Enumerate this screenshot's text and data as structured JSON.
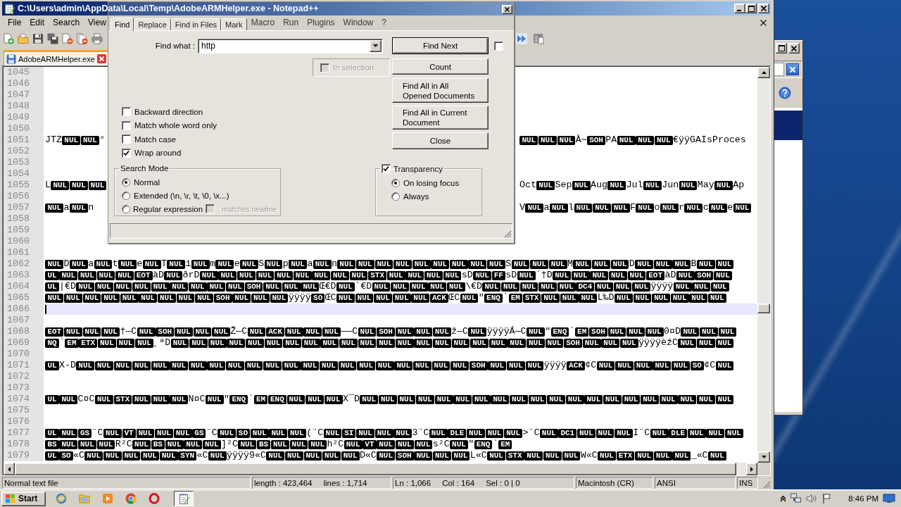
{
  "window": {
    "title": "C:\\Users\\admin\\AppData\\Local\\Temp\\AdobeARMHelper.exe - Notepad++"
  },
  "menu": {
    "items": [
      "File",
      "Edit",
      "Search",
      "View"
    ],
    "items_seen_through_dialog": [
      "Macro",
      "Run",
      "Plugins",
      "Window",
      "?"
    ]
  },
  "tabs": [
    {
      "label": "AdobeARMHelper.exe",
      "selected": true
    }
  ],
  "editor": {
    "lines": [
      {
        "number": "1045",
        "current": false
      },
      {
        "number": "1046",
        "current": false
      },
      {
        "number": "1047",
        "current": false
      },
      {
        "number": "1048",
        "current": false
      },
      {
        "number": "1049",
        "current": false
      },
      {
        "number": "1050",
        "current": false
      },
      {
        "number": "1051",
        "current": false,
        "left_part": [
          {
            "text": "JTZ"
          },
          {
            "ctrl": "NUL"
          },
          {
            "ctrl": "NUL"
          },
          {
            "text": "°"
          }
        ],
        "right_part": [
          {
            "ctrl": "NUL"
          },
          {
            "ctrl": "NUL"
          },
          {
            "ctrl": "NUL"
          },
          {
            "text": "À~"
          },
          {
            "ctrl": "SOH"
          },
          {
            "text": "PA"
          },
          {
            "ctrl": "NUL"
          },
          {
            "ctrl": "NUL"
          },
          {
            "ctrl": "NUL"
          },
          {
            "text": "€ÿÿGAIsProces"
          }
        ]
      },
      {
        "number": "1052",
        "current": false
      },
      {
        "number": "1053",
        "current": false
      },
      {
        "number": "1054",
        "current": false
      },
      {
        "number": "1055",
        "current": false,
        "left_part": [
          {
            "text": "L"
          },
          {
            "ctrl": "NUL"
          },
          {
            "ctrl": "NUL"
          },
          {
            "ctrl": "NUL"
          }
        ],
        "right_part": [
          {
            "text": "Oct"
          },
          {
            "ctrl": "NUL"
          },
          {
            "text": "Sep"
          },
          {
            "ctrl": "NUL"
          },
          {
            "text": "Aug"
          },
          {
            "ctrl": "NUL"
          },
          {
            "text": "Jul"
          },
          {
            "ctrl": "NUL"
          },
          {
            "text": "Jun"
          },
          {
            "ctrl": "NUL"
          },
          {
            "text": "May"
          },
          {
            "ctrl": "NUL"
          },
          {
            "text": "Ap"
          }
        ]
      },
      {
        "number": "1056",
        "current": false
      },
      {
        "number": "1057",
        "current": false,
        "left_part": [
          {
            "ctrl": "NUL"
          },
          {
            "text": "a"
          },
          {
            "ctrl": "NUL"
          },
          {
            "text": "n"
          }
        ],
        "right_part": [
          {
            "text": "V"
          },
          {
            "ctrl": "NUL"
          },
          {
            "text": "a"
          },
          {
            "ctrl": "NUL"
          },
          {
            "text": "l"
          },
          {
            "ctrl": "NUL"
          },
          {
            "ctrl": "NUL"
          },
          {
            "ctrl": "NUL"
          },
          {
            "text": "F"
          },
          {
            "ctrl": "NUL"
          },
          {
            "text": "o"
          },
          {
            "ctrl": "NUL"
          },
          {
            "text": "r"
          },
          {
            "ctrl": "NUL"
          },
          {
            "text": "c"
          },
          {
            "ctrl": "NUL"
          },
          {
            "text": "e"
          },
          {
            "ctrl": "NUL"
          }
        ]
      },
      {
        "number": "1058",
        "current": false
      },
      {
        "number": "1059",
        "current": false
      },
      {
        "number": "1060",
        "current": false
      },
      {
        "number": "1061",
        "current": false
      },
      {
        "number": "1062",
        "current": false,
        "segments": [
          {
            "ctrl": "NUL"
          },
          {
            "text": "D"
          },
          {
            "ctrl": "NUL"
          },
          {
            "text": "a"
          },
          {
            "ctrl": "NUL"
          },
          {
            "text": "t"
          },
          {
            "ctrl": "NUL"
          },
          {
            "text": "e"
          },
          {
            "ctrl": "NUL"
          },
          {
            "text": "T"
          },
          {
            "ctrl": "NUL"
          },
          {
            "text": "i"
          },
          {
            "ctrl": "NUL"
          },
          {
            "text": "m"
          },
          {
            "ctrl": "NUL"
          },
          {
            "text": "e"
          },
          {
            "ctrl": "NUL"
          },
          {
            "text": "S"
          },
          {
            "ctrl": "NUL"
          },
          {
            "text": "p"
          },
          {
            "ctrl": "NUL"
          },
          {
            "text": "a"
          },
          {
            "ctrl": "NUL"
          },
          {
            "text": "n"
          },
          {
            "ctrl": "NUL"
          },
          {
            "ctrl": "NUL"
          },
          {
            "ctrl": "NUL"
          },
          {
            "ctrl": "NUL"
          },
          {
            "ctrl": "NUL"
          },
          {
            "ctrl": "NUL"
          },
          {
            "ctrl": "NUL"
          },
          {
            "ctrl": "NUL"
          },
          {
            "ctrl": "NUL"
          },
          {
            "text": "S"
          },
          {
            "ctrl": "NUL"
          },
          {
            "ctrl": "NUL"
          },
          {
            "ctrl": "NUL"
          },
          {
            "text": "M"
          },
          {
            "ctrl": "NUL"
          },
          {
            "ctrl": "NUL"
          },
          {
            "ctrl": "NUL"
          },
          {
            "text": "D"
          },
          {
            "ctrl": "NUL"
          },
          {
            "ctrl": "NUL"
          },
          {
            "ctrl": "NUL"
          },
          {
            "text": "B"
          },
          {
            "ctrl": "NUL"
          },
          {
            "ctrl": "NUL"
          }
        ]
      },
      {
        "number": "1063",
        "current": false,
        "segments": [
          {
            "ctrl": "UL"
          },
          {
            "ctrl": "NUL"
          },
          {
            "ctrl": "NUL"
          },
          {
            "ctrl": "NUL"
          },
          {
            "ctrl": "NUL"
          },
          {
            "ctrl": "EOT"
          },
          {
            "text": "àD"
          },
          {
            "ctrl": "NUL"
          },
          {
            "text": "ðrD"
          },
          {
            "ctrl": "NUL"
          },
          {
            "ctrl": "NUL"
          },
          {
            "ctrl": "NUL"
          },
          {
            "ctrl": "NUL"
          },
          {
            "ctrl": "NUL"
          },
          {
            "ctrl": "NUL"
          },
          {
            "ctrl": "NUL"
          },
          {
            "ctrl": "NUL"
          },
          {
            "ctrl": "NUL"
          },
          {
            "ctrl": "STX"
          },
          {
            "ctrl": "NUL"
          },
          {
            "ctrl": "NUL"
          },
          {
            "ctrl": "NUL"
          },
          {
            "ctrl": "NUL"
          },
          {
            "text": "sD"
          },
          {
            "ctrl": "NUL"
          },
          {
            "ctrl": "FF"
          },
          {
            "text": "sD"
          },
          {
            "ctrl": "NUL"
          },
          {
            "text": "´†D"
          },
          {
            "ctrl": "NUL"
          },
          {
            "ctrl": "NUL"
          },
          {
            "ctrl": "NUL"
          },
          {
            "ctrl": "NUL"
          },
          {
            "ctrl": "NUL"
          },
          {
            "ctrl": "EOT"
          },
          {
            "text": "àD"
          },
          {
            "ctrl": "NUL"
          },
          {
            "ctrl": "SOH"
          },
          {
            "ctrl": "NUL"
          }
        ]
      },
      {
        "number": "1064",
        "current": false,
        "segments": [
          {
            "ctrl": "UL"
          },
          {
            "text": "|€D"
          },
          {
            "ctrl": "NUL"
          },
          {
            "ctrl": "NUL"
          },
          {
            "ctrl": "NUL"
          },
          {
            "ctrl": "NUL"
          },
          {
            "ctrl": "NUL"
          },
          {
            "ctrl": "NUL"
          },
          {
            "ctrl": "NUL"
          },
          {
            "ctrl": "NUL"
          },
          {
            "ctrl": "NUL"
          },
          {
            "ctrl": "SOH"
          },
          {
            "ctrl": "NUL"
          },
          {
            "ctrl": "NUL"
          },
          {
            "ctrl": "NUL"
          },
          {
            "text": "Œ€D"
          },
          {
            "ctrl": "NUL"
          },
          {
            "text": "`€D"
          },
          {
            "ctrl": "NUL"
          },
          {
            "ctrl": "NUL"
          },
          {
            "ctrl": "NUL"
          },
          {
            "ctrl": "NUL"
          },
          {
            "ctrl": "NUL"
          },
          {
            "text": "\\€D"
          },
          {
            "ctrl": "NUL"
          },
          {
            "ctrl": "NUL"
          },
          {
            "ctrl": "NUL"
          },
          {
            "ctrl": "NUL"
          },
          {
            "ctrl": "NUL"
          },
          {
            "ctrl": "DC4"
          },
          {
            "ctrl": "NUL"
          },
          {
            "ctrl": "NUL"
          },
          {
            "ctrl": "NUL"
          },
          {
            "text": "ÿÿÿÿ"
          },
          {
            "ctrl": "NUL"
          },
          {
            "ctrl": "NUL"
          },
          {
            "ctrl": "NUL"
          }
        ]
      },
      {
        "number": "1065",
        "current": false,
        "segments": [
          {
            "ctrl": "NUL"
          },
          {
            "ctrl": "NUL"
          },
          {
            "ctrl": "NUL"
          },
          {
            "ctrl": "NUL"
          },
          {
            "ctrl": "NUL"
          },
          {
            "ctrl": "NUL"
          },
          {
            "ctrl": "NUL"
          },
          {
            "ctrl": "NUL"
          },
          {
            "ctrl": "NUL"
          },
          {
            "ctrl": "SOH"
          },
          {
            "ctrl": "NUL"
          },
          {
            "ctrl": "NUL"
          },
          {
            "ctrl": "NUL"
          },
          {
            "text": "ÿÿÿÿ"
          },
          {
            "ctrl": "SO"
          },
          {
            "text": "ŒC"
          },
          {
            "ctrl": "NUL"
          },
          {
            "ctrl": "NUL"
          },
          {
            "ctrl": "NUL"
          },
          {
            "ctrl": "NUL"
          },
          {
            "ctrl": "NUL"
          },
          {
            "ctrl": "ACK"
          },
          {
            "text": "ŒC"
          },
          {
            "ctrl": "NUL"
          },
          {
            "text": "\""
          },
          {
            "ctrl": "ENQ"
          },
          {
            "text": "`"
          },
          {
            "ctrl": "EM"
          },
          {
            "ctrl": "STX"
          },
          {
            "ctrl": "NUL"
          },
          {
            "ctrl": "NUL"
          },
          {
            "ctrl": "NUL"
          },
          {
            "text": "L‰D"
          },
          {
            "ctrl": "NUL"
          },
          {
            "ctrl": "NUL"
          },
          {
            "ctrl": "NUL"
          },
          {
            "ctrl": "NUL"
          },
          {
            "ctrl": "NUL"
          },
          {
            "ctrl": "NUL"
          }
        ]
      },
      {
        "number": "1066",
        "current": true
      },
      {
        "number": "1067",
        "current": false
      },
      {
        "number": "1068",
        "current": false,
        "segments": [
          {
            "ctrl": "EOT"
          },
          {
            "ctrl": "NUL"
          },
          {
            "ctrl": "NUL"
          },
          {
            "ctrl": "NUL"
          },
          {
            "text": "†—C"
          },
          {
            "ctrl": "NUL"
          },
          {
            "ctrl": "SOH"
          },
          {
            "ctrl": "NUL"
          },
          {
            "ctrl": "NUL"
          },
          {
            "ctrl": "NUL"
          },
          {
            "text": "Ž—C"
          },
          {
            "ctrl": "NUL"
          },
          {
            "ctrl": "ACK"
          },
          {
            "ctrl": "NUL"
          },
          {
            "ctrl": "NUL"
          },
          {
            "ctrl": "NUL"
          },
          {
            "text": "——C"
          },
          {
            "ctrl": "NUL"
          },
          {
            "ctrl": "SOH"
          },
          {
            "ctrl": "NUL"
          },
          {
            "ctrl": "NUL"
          },
          {
            "ctrl": "NUL"
          },
          {
            "text": "ž—C"
          },
          {
            "ctrl": "NUL"
          },
          {
            "text": "ÿÿÿÿÁ—C"
          },
          {
            "ctrl": "NUL"
          },
          {
            "text": "\""
          },
          {
            "ctrl": "ENQ"
          },
          {
            "text": "`"
          },
          {
            "ctrl": "EM"
          },
          {
            "ctrl": "SOH"
          },
          {
            "ctrl": "NUL"
          },
          {
            "ctrl": "NUL"
          },
          {
            "ctrl": "NUL"
          },
          {
            "text": "0¤D"
          },
          {
            "ctrl": "NUL"
          },
          {
            "ctrl": "NUL"
          },
          {
            "ctrl": "NUL"
          }
        ]
      },
      {
        "number": "1069",
        "current": false,
        "segments": [
          {
            "ctrl": "NQ"
          },
          {
            "text": "`"
          },
          {
            "ctrl": "EM"
          },
          {
            "ctrl": "ETX"
          },
          {
            "ctrl": "NUL"
          },
          {
            "ctrl": "NUL"
          },
          {
            "ctrl": "NUL"
          },
          {
            "text": "¸ªD"
          },
          {
            "ctrl": "NUL"
          },
          {
            "ctrl": "NUL"
          },
          {
            "ctrl": "NUL"
          },
          {
            "ctrl": "NUL"
          },
          {
            "ctrl": "NUL"
          },
          {
            "ctrl": "NUL"
          },
          {
            "ctrl": "NUL"
          },
          {
            "ctrl": "NUL"
          },
          {
            "ctrl": "NUL"
          },
          {
            "ctrl": "NUL"
          },
          {
            "ctrl": "NUL"
          },
          {
            "ctrl": "NUL"
          },
          {
            "ctrl": "NUL"
          },
          {
            "ctrl": "NUL"
          },
          {
            "ctrl": "NUL"
          },
          {
            "ctrl": "NUL"
          },
          {
            "ctrl": "NUL"
          },
          {
            "ctrl": "NUL"
          },
          {
            "ctrl": "NUL"
          },
          {
            "ctrl": "NUL"
          },
          {
            "ctrl": "NUL"
          },
          {
            "ctrl": "SOH"
          },
          {
            "ctrl": "NUL"
          },
          {
            "ctrl": "NUL"
          },
          {
            "ctrl": "NUL"
          },
          {
            "text": "ÿÿÿÿèžC"
          },
          {
            "ctrl": "NUL"
          },
          {
            "ctrl": "NUL"
          },
          {
            "ctrl": "NUL"
          }
        ]
      },
      {
        "number": "1070",
        "current": false
      },
      {
        "number": "1071",
        "current": false,
        "segments": [
          {
            "ctrl": "UL"
          },
          {
            "text": "X-D"
          },
          {
            "ctrl": "NUL"
          },
          {
            "ctrl": "NUL"
          },
          {
            "ctrl": "NUL"
          },
          {
            "ctrl": "NUL"
          },
          {
            "ctrl": "NUL"
          },
          {
            "ctrl": "NUL"
          },
          {
            "ctrl": "NUL"
          },
          {
            "ctrl": "NUL"
          },
          {
            "ctrl": "NUL"
          },
          {
            "ctrl": "NUL"
          },
          {
            "ctrl": "NUL"
          },
          {
            "ctrl": "NUL"
          },
          {
            "ctrl": "NUL"
          },
          {
            "ctrl": "NUL"
          },
          {
            "ctrl": "NUL"
          },
          {
            "ctrl": "NUL"
          },
          {
            "ctrl": "NUL"
          },
          {
            "ctrl": "NUL"
          },
          {
            "ctrl": "NUL"
          },
          {
            "ctrl": "NUL"
          },
          {
            "ctrl": "NUL"
          },
          {
            "ctrl": "SOH"
          },
          {
            "ctrl": "NUL"
          },
          {
            "ctrl": "NUL"
          },
          {
            "ctrl": "NUL"
          },
          {
            "text": "ÿÿÿÿ"
          },
          {
            "ctrl": "ACK"
          },
          {
            "text": "¢C"
          },
          {
            "ctrl": "NUL"
          },
          {
            "ctrl": "NUL"
          },
          {
            "ctrl": "NUL"
          },
          {
            "ctrl": "NUL"
          },
          {
            "ctrl": "NUL"
          },
          {
            "ctrl": "SO"
          },
          {
            "text": "¢C"
          },
          {
            "ctrl": "NUL"
          }
        ]
      },
      {
        "number": "1072",
        "current": false
      },
      {
        "number": "1073",
        "current": false
      },
      {
        "number": "1074",
        "current": false,
        "segments": [
          {
            "ctrl": "UL"
          },
          {
            "ctrl": "NUL"
          },
          {
            "text": "C¤C"
          },
          {
            "ctrl": "NUL"
          },
          {
            "ctrl": "STX"
          },
          {
            "ctrl": "NUL"
          },
          {
            "ctrl": "NUL"
          },
          {
            "ctrl": "NUL"
          },
          {
            "text": "N¤C"
          },
          {
            "ctrl": "NUL"
          },
          {
            "text": "\""
          },
          {
            "ctrl": "ENQ"
          },
          {
            "text": "`"
          },
          {
            "ctrl": "EM"
          },
          {
            "ctrl": "ENQ"
          },
          {
            "ctrl": "NUL"
          },
          {
            "ctrl": "NUL"
          },
          {
            "ctrl": "NUL"
          },
          {
            "text": "X¯D"
          },
          {
            "ctrl": "NUL"
          },
          {
            "ctrl": "NUL"
          },
          {
            "ctrl": "NUL"
          },
          {
            "ctrl": "NUL"
          },
          {
            "ctrl": "NUL"
          },
          {
            "ctrl": "NUL"
          },
          {
            "ctrl": "NUL"
          },
          {
            "ctrl": "NUL"
          },
          {
            "ctrl": "NUL"
          },
          {
            "ctrl": "NUL"
          },
          {
            "ctrl": "NUL"
          },
          {
            "ctrl": "NUL"
          },
          {
            "ctrl": "NUL"
          },
          {
            "ctrl": "NUL"
          },
          {
            "ctrl": "NUL"
          },
          {
            "ctrl": "NUL"
          },
          {
            "ctrl": "NUL"
          },
          {
            "ctrl": "NUL"
          },
          {
            "ctrl": "NUL"
          },
          {
            "ctrl": "NUL"
          }
        ]
      },
      {
        "number": "1075",
        "current": false
      },
      {
        "number": "1076",
        "current": false
      },
      {
        "number": "1077",
        "current": false,
        "segments": [
          {
            "ctrl": "UL"
          },
          {
            "ctrl": "NUL"
          },
          {
            "ctrl": "GS"
          },
          {
            "text": "¨C"
          },
          {
            "ctrl": "NUL"
          },
          {
            "ctrl": "VT"
          },
          {
            "ctrl": "NUL"
          },
          {
            "ctrl": "NUL"
          },
          {
            "ctrl": "NUL"
          },
          {
            "ctrl": "GS"
          },
          {
            "text": "¨C"
          },
          {
            "ctrl": "NUL"
          },
          {
            "ctrl": "SO"
          },
          {
            "ctrl": "NUL"
          },
          {
            "ctrl": "NUL"
          },
          {
            "ctrl": "NUL"
          },
          {
            "text": "(¨C"
          },
          {
            "ctrl": "NUL"
          },
          {
            "ctrl": "SI"
          },
          {
            "ctrl": "NUL"
          },
          {
            "ctrl": "NUL"
          },
          {
            "ctrl": "NUL"
          },
          {
            "text": "3¨C"
          },
          {
            "ctrl": "NUL"
          },
          {
            "ctrl": "DLE"
          },
          {
            "ctrl": "NUL"
          },
          {
            "ctrl": "NUL"
          },
          {
            "ctrl": "NUL"
          },
          {
            "text": ">¨C"
          },
          {
            "ctrl": "NUL"
          },
          {
            "ctrl": "DC1"
          },
          {
            "ctrl": "NUL"
          },
          {
            "ctrl": "NUL"
          },
          {
            "ctrl": "NUL"
          },
          {
            "text": "I¨C"
          },
          {
            "ctrl": "NUL"
          },
          {
            "ctrl": "DLE"
          },
          {
            "ctrl": "NUL"
          },
          {
            "ctrl": "NUL"
          },
          {
            "ctrl": "NUL"
          }
        ]
      },
      {
        "number": "1078",
        "current": false,
        "segments": [
          {
            "ctrl": "BS"
          },
          {
            "ctrl": "NUL"
          },
          {
            "ctrl": "NUL"
          },
          {
            "ctrl": "NUL"
          },
          {
            "text": "R²C"
          },
          {
            "ctrl": "NUL"
          },
          {
            "ctrl": "BS"
          },
          {
            "ctrl": "NUL"
          },
          {
            "ctrl": "NUL"
          },
          {
            "ctrl": "NUL"
          },
          {
            "text": "]²C"
          },
          {
            "ctrl": "NUL"
          },
          {
            "ctrl": "BS"
          },
          {
            "ctrl": "NUL"
          },
          {
            "ctrl": "NUL"
          },
          {
            "ctrl": "NUL"
          },
          {
            "text": "h²C"
          },
          {
            "ctrl": "NUL"
          },
          {
            "ctrl": "VT"
          },
          {
            "ctrl": "NUL"
          },
          {
            "ctrl": "NUL"
          },
          {
            "ctrl": "NUL"
          },
          {
            "text": "s²C"
          },
          {
            "ctrl": "NUL"
          },
          {
            "text": "\""
          },
          {
            "ctrl": "ENQ"
          },
          {
            "text": "`"
          },
          {
            "ctrl": "EM"
          }
        ]
      },
      {
        "number": "1079",
        "current": false,
        "segments": [
          {
            "ctrl": "UL"
          },
          {
            "ctrl": "SO"
          },
          {
            "text": "«C"
          },
          {
            "ctrl": "NUL"
          },
          {
            "ctrl": "NUL"
          },
          {
            "ctrl": "NUL"
          },
          {
            "ctrl": "NUL"
          },
          {
            "ctrl": "NUL"
          },
          {
            "ctrl": "SYN"
          },
          {
            "text": "«C"
          },
          {
            "ctrl": "NUL"
          },
          {
            "text": "ÿÿÿÿ9«C"
          },
          {
            "ctrl": "NUL"
          },
          {
            "ctrl": "NUL"
          },
          {
            "ctrl": "NUL"
          },
          {
            "ctrl": "NUL"
          },
          {
            "ctrl": "NUL"
          },
          {
            "text": "D«C"
          },
          {
            "ctrl": "NUL"
          },
          {
            "ctrl": "SOH"
          },
          {
            "ctrl": "NUL"
          },
          {
            "ctrl": "NUL"
          },
          {
            "ctrl": "NUL"
          },
          {
            "text": "L«C"
          },
          {
            "ctrl": "NUL"
          },
          {
            "ctrl": "STX"
          },
          {
            "ctrl": "NUL"
          },
          {
            "ctrl": "NUL"
          },
          {
            "ctrl": "NUL"
          },
          {
            "text": "W«C"
          },
          {
            "ctrl": "NUL"
          },
          {
            "ctrl": "ETX"
          },
          {
            "ctrl": "NUL"
          },
          {
            "ctrl": "NUL"
          },
          {
            "ctrl": "NUL"
          },
          {
            "text": "_«C"
          },
          {
            "ctrl": "NUL"
          }
        ]
      }
    ]
  },
  "status_bar": {
    "cells": [
      [
        "Normal text file"
      ],
      [
        "length : 423,464",
        "lines : 1,714"
      ],
      [
        "Ln : 1,066",
        "Col : 164",
        "Sel : 0 | 0"
      ],
      [
        "Macintosh (CR)"
      ],
      [
        "ANSI"
      ],
      [
        "INS"
      ]
    ]
  },
  "find_dialog": {
    "tabs": [
      {
        "label": "Find",
        "selected": true
      },
      {
        "label": "Replace",
        "selected": false
      },
      {
        "label": "Find in Files",
        "selected": false
      },
      {
        "label": "Mark",
        "selected": false
      }
    ],
    "find_what": {
      "label": "Find what :",
      "value": "http"
    },
    "buttons": [
      {
        "label": "Find Next",
        "default": true
      },
      {
        "label": "Count",
        "default": false
      },
      {
        "label": "Find All in All Opened Documents",
        "default": false
      },
      {
        "label": "Find All in Current Document",
        "default": false
      },
      {
        "label": "Close",
        "default": false
      }
    ],
    "extra_checkbox": {
      "checked": false
    },
    "in_selection": {
      "label": "In selection",
      "checked": false,
      "disabled": true
    },
    "options": [
      {
        "label": "Backward direction",
        "checked": false
      },
      {
        "label": "Match whole word only",
        "checked": false
      },
      {
        "label": "Match case",
        "checked": false
      },
      {
        "label": "Wrap around",
        "checked": true
      }
    ],
    "search_mode": {
      "title": "Search Mode",
      "modes": [
        {
          "label": "Normal",
          "selected": true
        },
        {
          "label": "Extended (\\n, \\r, \\t, \\0, \\x...)",
          "selected": false
        },
        {
          "label": "Regular expression",
          "selected": false
        }
      ],
      "matches_newline": {
        "label": ". matches newline",
        "checked": false,
        "disabled": true
      }
    },
    "transparency": {
      "label": "Transparency",
      "checked": true,
      "modes": [
        {
          "label": "On losing focus",
          "selected": true
        },
        {
          "label": "Always",
          "selected": false
        }
      ]
    }
  },
  "taskbar": {
    "start_label": "Start",
    "window_button": {
      "active": true
    },
    "clock": "8:46 PM"
  }
}
